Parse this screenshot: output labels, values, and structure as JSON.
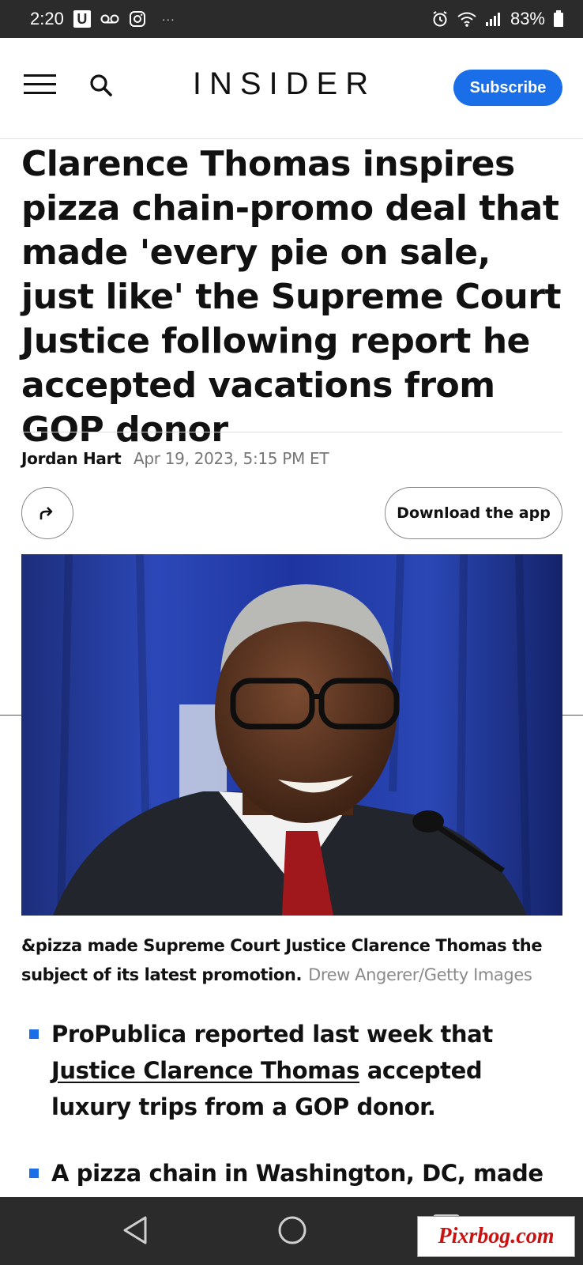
{
  "status_bar": {
    "time": "2:20",
    "battery": "83%",
    "icons": [
      "u-app-icon",
      "voicemail-icon",
      "instagram-icon",
      "more-dots-icon",
      "alarm-icon",
      "wifi-icon",
      "signal-icon",
      "battery-icon"
    ]
  },
  "header": {
    "logo": "INSIDER",
    "subscribe_label": "Subscribe",
    "icons": [
      "menu-icon",
      "search-icon"
    ]
  },
  "article": {
    "headline": "Clarence Thomas inspires pizza chain-promo deal that made 'every pie on sale, just like' the Supreme Court Justice following report he accepted vacations from GOP donor",
    "author": "Jordan Hart",
    "date": "Apr 19, 2023, 5:15 PM ET",
    "download_label": "Download the app",
    "caption": "&pizza made Supreme Court Justice Clarence Thomas the subject of its latest promotion.",
    "photo_credit": "Drew Angerer/Getty Images",
    "bullets": [
      {
        "before": "ProPublica reported last week that ",
        "link": "Justice Clarence Thomas",
        "after": " accepted luxury trips from a GOP donor."
      },
      {
        "before": "A pizza chain in Washington, DC, made",
        "link": "",
        "after": ""
      }
    ]
  },
  "watermark": "Pixrbog.com",
  "colors": {
    "accent": "#1a6ee8",
    "status_bar_bg": "#2b2b2b"
  }
}
